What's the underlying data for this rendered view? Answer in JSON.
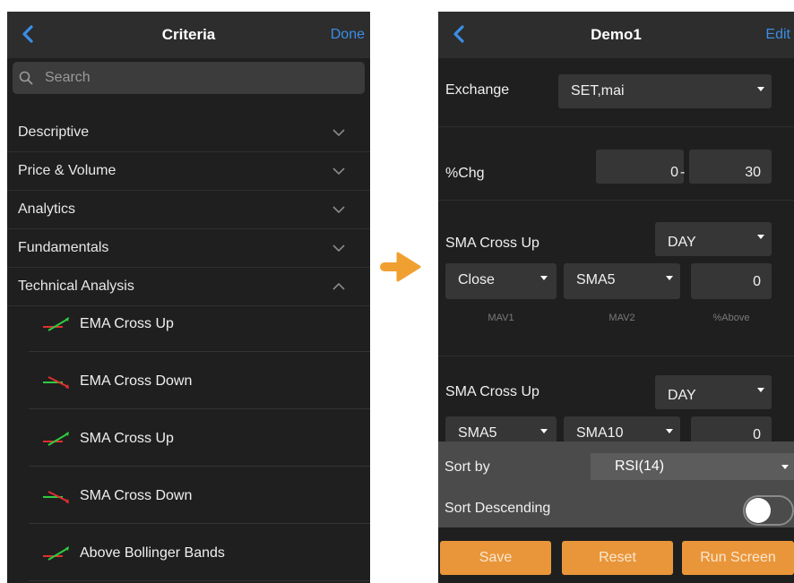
{
  "left": {
    "nav": {
      "title": "Criteria",
      "done_label": "Done"
    },
    "search": {
      "placeholder": "Search",
      "value": ""
    },
    "categories": [
      {
        "label": "Descriptive",
        "state": "collapsed"
      },
      {
        "label": "Price & Volume",
        "state": "collapsed"
      },
      {
        "label": "Analytics",
        "state": "collapsed"
      },
      {
        "label": "Fundamentals",
        "state": "collapsed"
      },
      {
        "label": "Technical Analysis",
        "state": "expanded"
      }
    ],
    "technical_items": [
      {
        "label": "EMA Cross Up",
        "icon": "cross-up-icon"
      },
      {
        "label": "EMA Cross Down",
        "icon": "cross-down-icon"
      },
      {
        "label": "SMA Cross Up",
        "icon": "cross-up-icon"
      },
      {
        "label": "SMA Cross Down",
        "icon": "cross-down-icon"
      },
      {
        "label": "Above Bollinger Bands",
        "icon": "cross-up-icon"
      }
    ]
  },
  "right": {
    "nav": {
      "title": "Demo1",
      "edit_label": "Edit"
    },
    "exchange": {
      "label": "Exchange",
      "value": "SET,mai"
    },
    "chg": {
      "label": "%Chg",
      "from": "0",
      "sep": "-",
      "to": "30"
    },
    "sma1": {
      "label": "SMA Cross Up",
      "period": "DAY",
      "mav1": "Close",
      "mav2": "SMA5",
      "above": "0",
      "mav1_caption": "MAV1",
      "mav2_caption": "MAV2",
      "above_caption": "%Above"
    },
    "sma2": {
      "label": "SMA Cross Up",
      "period": "DAY",
      "mav1": "SMA5",
      "mav2": "SMA10",
      "above": "0"
    },
    "sort": {
      "label": "Sort by",
      "value": "RSI(14)",
      "desc_label": "Sort Descending",
      "descending": false
    },
    "buttons": {
      "save": "Save",
      "reset": "Reset",
      "run": "Run Screen"
    }
  },
  "colors": {
    "accent_blue": "#3a8ee6",
    "button_orange": "#e9963a",
    "arrow_orange": "#f0a030",
    "background": "#1f1f1f",
    "cross_up_line": "#2ecc40",
    "cross_down_line": "#e03030"
  }
}
